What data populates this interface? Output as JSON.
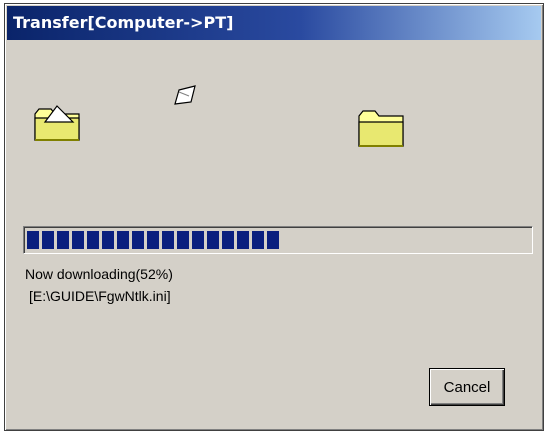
{
  "window": {
    "title": "Transfer[Computer->PT]"
  },
  "icons": {
    "source_folder": "folder-open-icon",
    "destination_folder": "folder-icon",
    "flying_document": "document-icon"
  },
  "progress": {
    "percent": 52,
    "segment_color": "#0a1f7e"
  },
  "status": {
    "message": "Now downloading(52%)",
    "file": " [E:\\GUIDE\\FgwNtlk.ini]"
  },
  "buttons": {
    "cancel_label": "Cancel"
  },
  "colors": {
    "titlebar_start": "#0a246a",
    "titlebar_end": "#a6caf0",
    "dialog_face": "#d4d0c8"
  }
}
